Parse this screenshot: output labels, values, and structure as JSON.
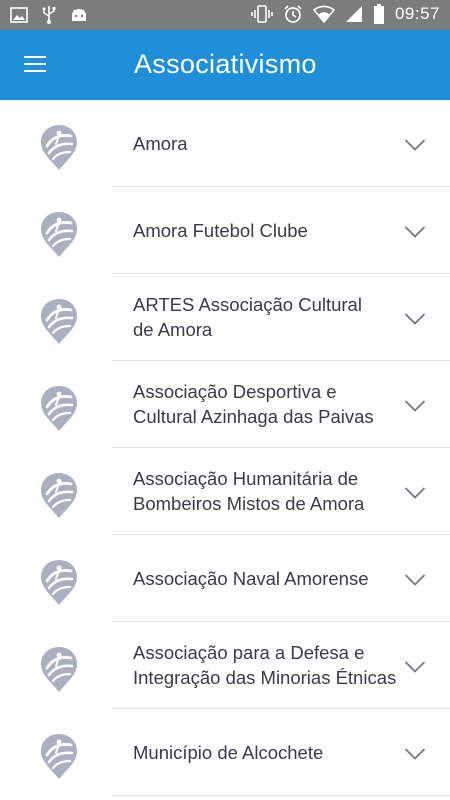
{
  "status_bar": {
    "time": "09:57",
    "left_icons": [
      "image-icon",
      "usb-icon",
      "android-icon"
    ],
    "right_icons": [
      "vibrate-icon",
      "alarm-icon",
      "wifi-icon",
      "signal-icon",
      "battery-icon"
    ]
  },
  "app_bar": {
    "title": "Associativismo",
    "menu_icon": "hamburger-menu-icon",
    "background": "#1e8fd8"
  },
  "list": {
    "items": [
      {
        "label": "Amora"
      },
      {
        "label": "Amora Futebol Clube"
      },
      {
        "label": "ARTES Associação Cultural\nde Amora"
      },
      {
        "label": "Associação Desportiva e\nCultural  Azinhaga das Paivas"
      },
      {
        "label": "Associação  Humanitária de\nBombeiros Mistos de Amora"
      },
      {
        "label": "Associação Naval Amorense"
      },
      {
        "label": "Associação  para a Defesa e\nIntegração das Minorias Étnicas"
      },
      {
        "label": "Município de Alcochete"
      }
    ],
    "item_icon": "association-logo-icon",
    "expand_icon": "chevron-down-icon"
  }
}
